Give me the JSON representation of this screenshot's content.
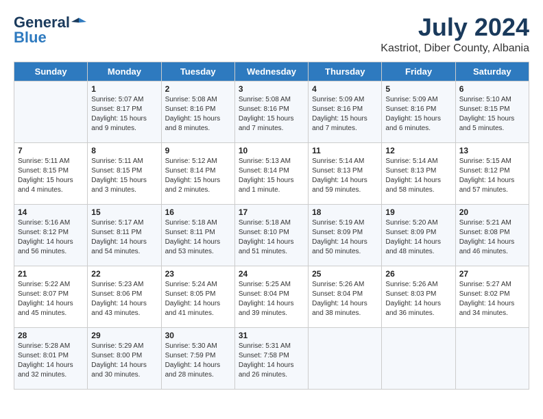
{
  "logo": {
    "line1": "General",
    "line2": "Blue"
  },
  "title": {
    "month_year": "July 2024",
    "location": "Kastriot, Diber County, Albania"
  },
  "days_of_week": [
    "Sunday",
    "Monday",
    "Tuesday",
    "Wednesday",
    "Thursday",
    "Friday",
    "Saturday"
  ],
  "weeks": [
    [
      {
        "day": "",
        "info": ""
      },
      {
        "day": "1",
        "info": "Sunrise: 5:07 AM\nSunset: 8:17 PM\nDaylight: 15 hours\nand 9 minutes."
      },
      {
        "day": "2",
        "info": "Sunrise: 5:08 AM\nSunset: 8:16 PM\nDaylight: 15 hours\nand 8 minutes."
      },
      {
        "day": "3",
        "info": "Sunrise: 5:08 AM\nSunset: 8:16 PM\nDaylight: 15 hours\nand 7 minutes."
      },
      {
        "day": "4",
        "info": "Sunrise: 5:09 AM\nSunset: 8:16 PM\nDaylight: 15 hours\nand 7 minutes."
      },
      {
        "day": "5",
        "info": "Sunrise: 5:09 AM\nSunset: 8:16 PM\nDaylight: 15 hours\nand 6 minutes."
      },
      {
        "day": "6",
        "info": "Sunrise: 5:10 AM\nSunset: 8:15 PM\nDaylight: 15 hours\nand 5 minutes."
      }
    ],
    [
      {
        "day": "7",
        "info": "Sunrise: 5:11 AM\nSunset: 8:15 PM\nDaylight: 15 hours\nand 4 minutes."
      },
      {
        "day": "8",
        "info": "Sunrise: 5:11 AM\nSunset: 8:15 PM\nDaylight: 15 hours\nand 3 minutes."
      },
      {
        "day": "9",
        "info": "Sunrise: 5:12 AM\nSunset: 8:14 PM\nDaylight: 15 hours\nand 2 minutes."
      },
      {
        "day": "10",
        "info": "Sunrise: 5:13 AM\nSunset: 8:14 PM\nDaylight: 15 hours\nand 1 minute."
      },
      {
        "day": "11",
        "info": "Sunrise: 5:14 AM\nSunset: 8:13 PM\nDaylight: 14 hours\nand 59 minutes."
      },
      {
        "day": "12",
        "info": "Sunrise: 5:14 AM\nSunset: 8:13 PM\nDaylight: 14 hours\nand 58 minutes."
      },
      {
        "day": "13",
        "info": "Sunrise: 5:15 AM\nSunset: 8:12 PM\nDaylight: 14 hours\nand 57 minutes."
      }
    ],
    [
      {
        "day": "14",
        "info": "Sunrise: 5:16 AM\nSunset: 8:12 PM\nDaylight: 14 hours\nand 56 minutes."
      },
      {
        "day": "15",
        "info": "Sunrise: 5:17 AM\nSunset: 8:11 PM\nDaylight: 14 hours\nand 54 minutes."
      },
      {
        "day": "16",
        "info": "Sunrise: 5:18 AM\nSunset: 8:11 PM\nDaylight: 14 hours\nand 53 minutes."
      },
      {
        "day": "17",
        "info": "Sunrise: 5:18 AM\nSunset: 8:10 PM\nDaylight: 14 hours\nand 51 minutes."
      },
      {
        "day": "18",
        "info": "Sunrise: 5:19 AM\nSunset: 8:09 PM\nDaylight: 14 hours\nand 50 minutes."
      },
      {
        "day": "19",
        "info": "Sunrise: 5:20 AM\nSunset: 8:09 PM\nDaylight: 14 hours\nand 48 minutes."
      },
      {
        "day": "20",
        "info": "Sunrise: 5:21 AM\nSunset: 8:08 PM\nDaylight: 14 hours\nand 46 minutes."
      }
    ],
    [
      {
        "day": "21",
        "info": "Sunrise: 5:22 AM\nSunset: 8:07 PM\nDaylight: 14 hours\nand 45 minutes."
      },
      {
        "day": "22",
        "info": "Sunrise: 5:23 AM\nSunset: 8:06 PM\nDaylight: 14 hours\nand 43 minutes."
      },
      {
        "day": "23",
        "info": "Sunrise: 5:24 AM\nSunset: 8:05 PM\nDaylight: 14 hours\nand 41 minutes."
      },
      {
        "day": "24",
        "info": "Sunrise: 5:25 AM\nSunset: 8:04 PM\nDaylight: 14 hours\nand 39 minutes."
      },
      {
        "day": "25",
        "info": "Sunrise: 5:26 AM\nSunset: 8:04 PM\nDaylight: 14 hours\nand 38 minutes."
      },
      {
        "day": "26",
        "info": "Sunrise: 5:26 AM\nSunset: 8:03 PM\nDaylight: 14 hours\nand 36 minutes."
      },
      {
        "day": "27",
        "info": "Sunrise: 5:27 AM\nSunset: 8:02 PM\nDaylight: 14 hours\nand 34 minutes."
      }
    ],
    [
      {
        "day": "28",
        "info": "Sunrise: 5:28 AM\nSunset: 8:01 PM\nDaylight: 14 hours\nand 32 minutes."
      },
      {
        "day": "29",
        "info": "Sunrise: 5:29 AM\nSunset: 8:00 PM\nDaylight: 14 hours\nand 30 minutes."
      },
      {
        "day": "30",
        "info": "Sunrise: 5:30 AM\nSunset: 7:59 PM\nDaylight: 14 hours\nand 28 minutes."
      },
      {
        "day": "31",
        "info": "Sunrise: 5:31 AM\nSunset: 7:58 PM\nDaylight: 14 hours\nand 26 minutes."
      },
      {
        "day": "",
        "info": ""
      },
      {
        "day": "",
        "info": ""
      },
      {
        "day": "",
        "info": ""
      }
    ]
  ]
}
